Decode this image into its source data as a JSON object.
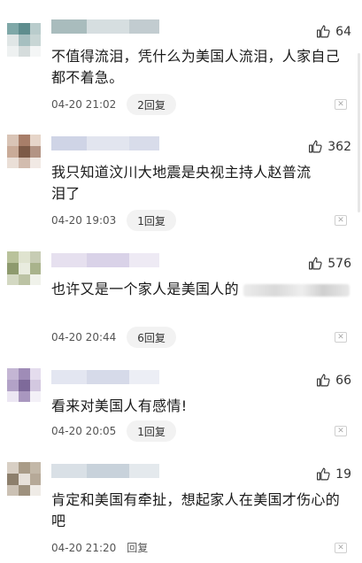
{
  "comments": [
    {
      "text": "不值得流泪，凭什么为美国人流泪，人家自己都不着急。",
      "time": "04-20 21:02",
      "replies": "2回复",
      "likes": "64",
      "colors": [
        "#7fa8a8",
        "#5e8d8e",
        "#b9cccc",
        "#e0e6e6",
        "#a6bfc0",
        "#c8d6d5",
        "#eef1f1",
        "#d5dcdc",
        "#f4f6f6"
      ],
      "name_colors": [
        "#a9bcbd",
        "#d6dee0",
        "#c2ccd0"
      ]
    },
    {
      "text": "我只知道汶川大地震是央视主持人赵普流泪了",
      "time": "04-20 19:03",
      "replies": "1回复",
      "likes": "362",
      "colors": [
        "#d9c4b6",
        "#a87e69",
        "#e6d5c9",
        "#c9ab98",
        "#7d5a47",
        "#b39484",
        "#eadfd7",
        "#d2bcae",
        "#f1e9e4"
      ],
      "name_colors": [
        "#cfd4e6",
        "#e2e5ef",
        "#d8dcea"
      ]
    },
    {
      "text": "也许又是一个家人是美国人的",
      "time": "04-20 20:44",
      "replies": "6回复",
      "likes": "576",
      "colors": [
        "#b9c29b",
        "#dfe3cf",
        "#c7ccb4",
        "#8e9a6e",
        "#e9ecdf",
        "#a9b38c",
        "#d3d8c2",
        "#bcc3a4",
        "#f0f2ea"
      ],
      "name_colors": [
        "#e6e0ef",
        "#d9d2e8",
        "#eeeaf4"
      ]
    },
    {
      "text": "看来对美国人有感情!",
      "time": "04-20 20:05",
      "replies": "1回复",
      "likes": "66",
      "colors": [
        "#c4b6d4",
        "#9f8cb7",
        "#e4dced",
        "#b2a2c7",
        "#7e6a9a",
        "#d3c8e0",
        "#ece7f3",
        "#a997bf",
        "#f3f0f7"
      ],
      "name_colors": [
        "#e3e6f1",
        "#d6dae9",
        "#eceef5"
      ]
    },
    {
      "text": "肯定和美国有牵扯，想起家人在美国才伤心的吧",
      "time": "04-20 21:20",
      "replies": "回复",
      "likes": "19",
      "colors": [
        "#d8cfc4",
        "#a99b87",
        "#c3b8a8",
        "#8d7f6c",
        "#e7e1da",
        "#b6a998",
        "#cbc1b4",
        "#9e917e",
        "#efebe6"
      ],
      "name_colors": [
        "#d9e0e6",
        "#c8d2db",
        "#e4e9ed"
      ]
    }
  ],
  "icons": {
    "like": "thumbs-up-icon",
    "close": "close-icon"
  },
  "close_glyph": "✕"
}
